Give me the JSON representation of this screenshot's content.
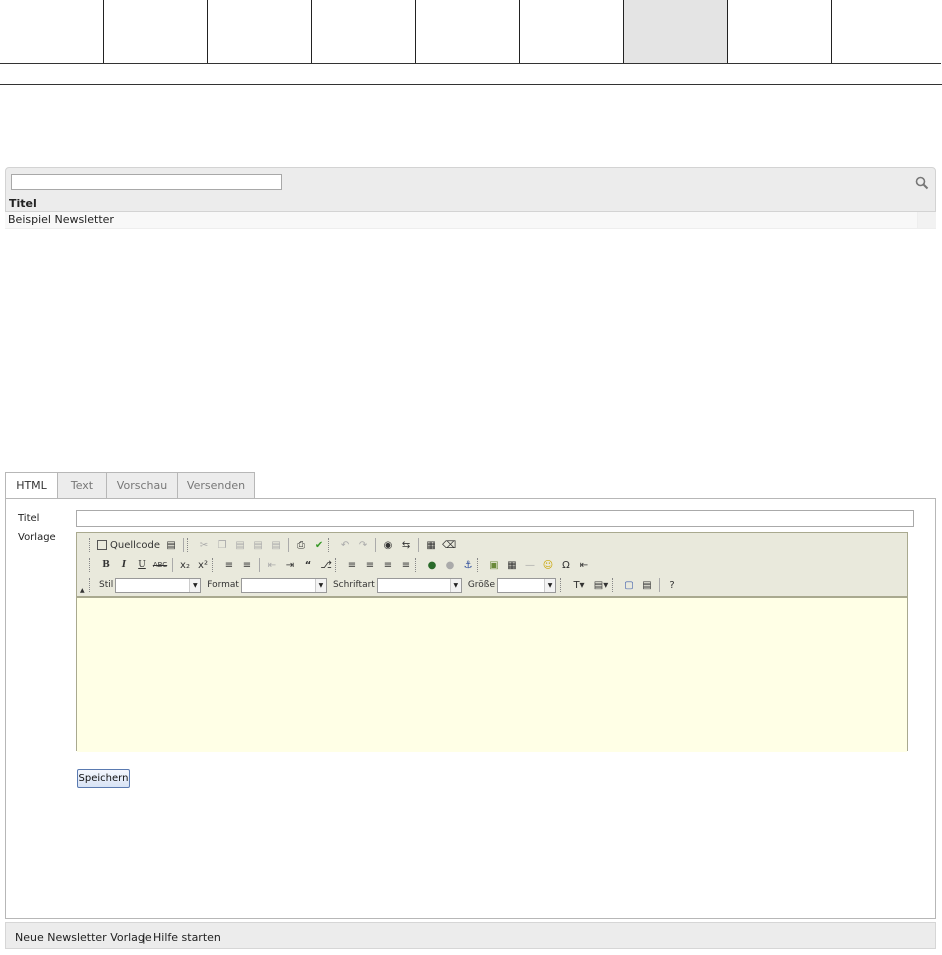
{
  "top_nav": {
    "cell_count": 9,
    "active_index": 6
  },
  "list": {
    "search": {
      "value": "",
      "placeholder": ""
    },
    "column_header": "Titel",
    "rows": [
      {
        "title": "Beispiel Newsletter"
      }
    ]
  },
  "tabs": [
    {
      "label": "HTML",
      "active": true
    },
    {
      "label": "Text",
      "active": false
    },
    {
      "label": "Vorschau",
      "active": false
    },
    {
      "label": "Versenden",
      "active": false
    }
  ],
  "form": {
    "title_label": "Titel",
    "title_value": "",
    "template_label": "Vorlage",
    "save_label": "Speichern"
  },
  "editor": {
    "source_label": "Quellcode",
    "style_label": "Stil",
    "format_label": "Format",
    "font_label": "Schriftart",
    "size_label": "Größe",
    "body_bg": "#ffffe6",
    "toolbar_bg": "#e9e9dc"
  },
  "footer": {
    "new_template": "Neue Newsletter Vorlage",
    "separator": "|",
    "help": "Hilfe starten"
  }
}
